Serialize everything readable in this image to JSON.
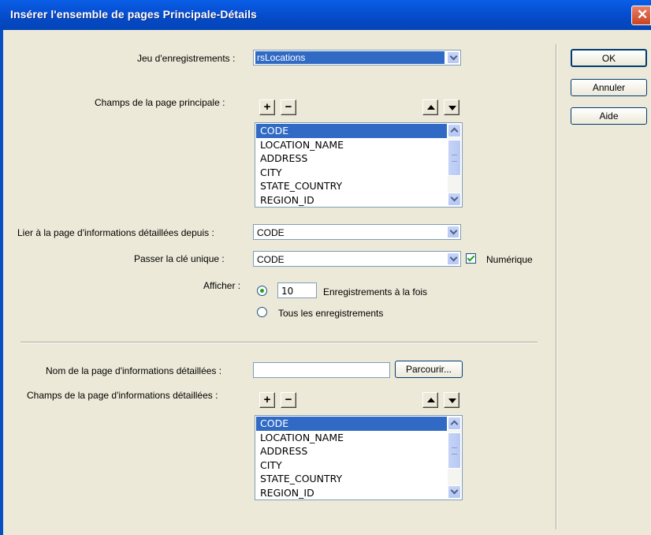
{
  "window": {
    "title": "Insérer l'ensemble de pages Principale-Détails",
    "close_icon": "close-icon"
  },
  "buttons": {
    "ok": "OK",
    "cancel": "Annuler",
    "help": "Aide",
    "browse": "Parcourir..."
  },
  "recordset": {
    "label": "Jeu d'enregistrements :",
    "value": "rsLocations"
  },
  "master_fields": {
    "label": "Champs de la page principale :",
    "add_label": "+",
    "remove_label": "−",
    "items": [
      "CODE",
      "LOCATION_NAME",
      "ADDRESS",
      "CITY",
      "STATE_COUNTRY",
      "REGION_ID"
    ],
    "selected": "CODE"
  },
  "link_detail": {
    "label": "Lier à la page d'informations détaillées depuis :",
    "value": "CODE"
  },
  "unique_key": {
    "label": "Passer la clé unique :",
    "value": "CODE",
    "numeric_label": "Numérique",
    "numeric_checked": true
  },
  "show": {
    "label": "Afficher :",
    "count_value": "10",
    "records_at_once_label": "Enregistrements à la fois",
    "all_records_label": "Tous les enregistrements",
    "selected_option": "records_at_once"
  },
  "detail_page": {
    "name_label": "Nom de la page d'informations détaillées :",
    "name_value": "",
    "fields_label": "Champs de la page d'informations détaillées :",
    "add_label": "+",
    "remove_label": "−",
    "items": [
      "CODE",
      "LOCATION_NAME",
      "ADDRESS",
      "CITY",
      "STATE_COUNTRY",
      "REGION_ID"
    ],
    "selected": "CODE"
  },
  "colors": {
    "titlebar": "#0450c4",
    "dialog_bg": "#ece9d8",
    "selection": "#316ac5",
    "check_green": "#21a121"
  }
}
